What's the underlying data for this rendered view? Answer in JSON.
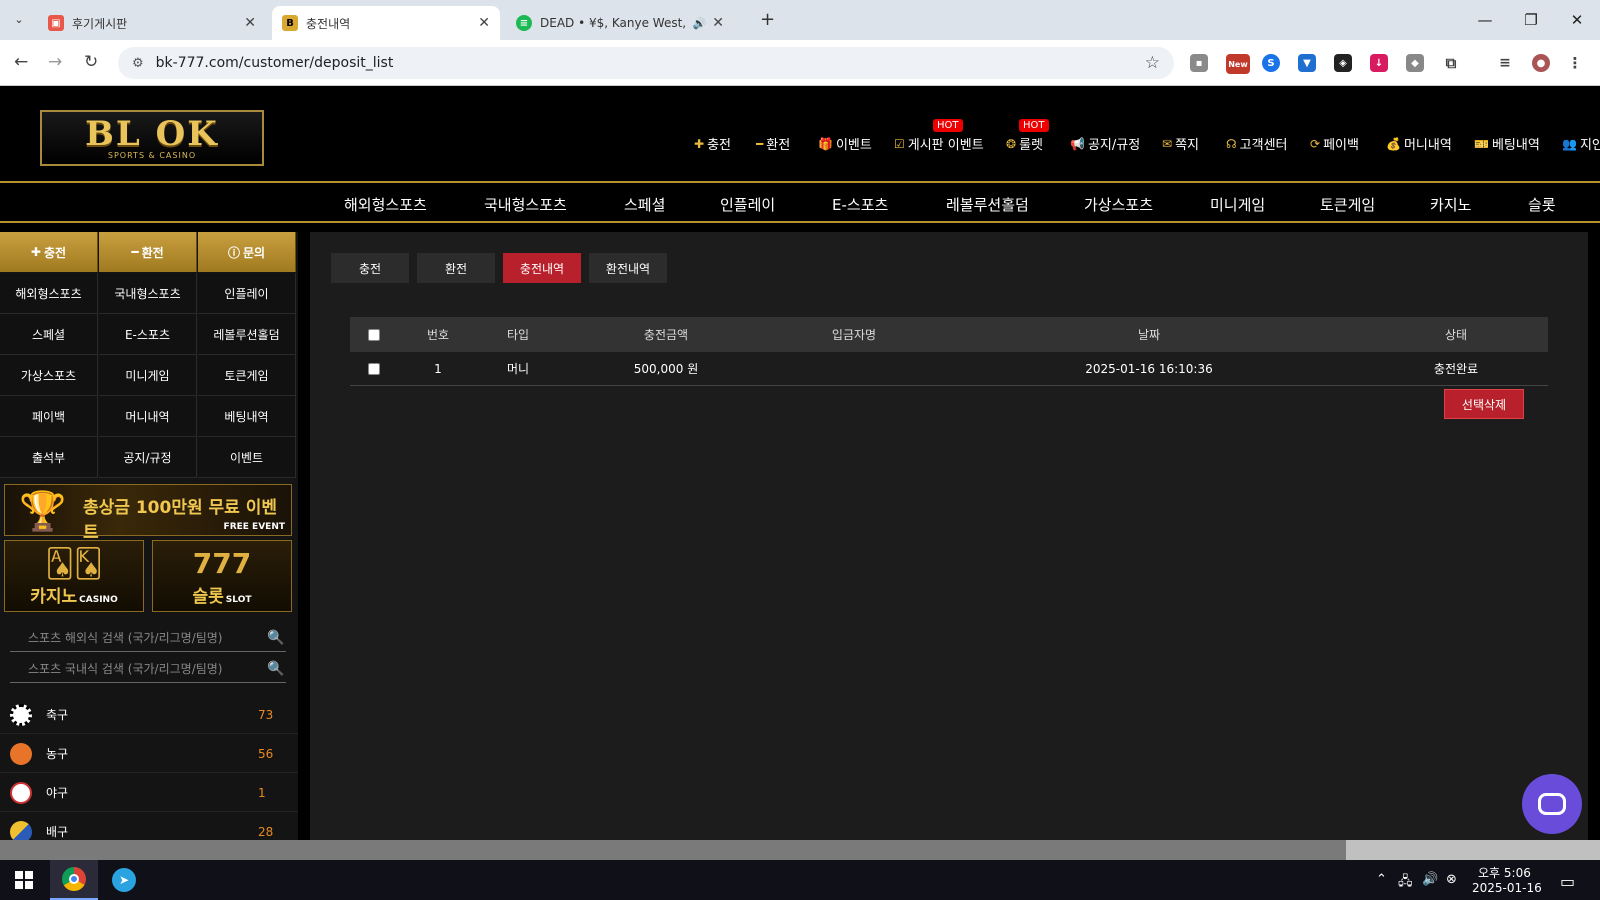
{
  "browser": {
    "tabs": [
      {
        "title": "후기게시판",
        "active": false
      },
      {
        "title": "충전내역",
        "active": true
      },
      {
        "title": "DEAD • ¥$, Kanye West, Ty",
        "active": false
      }
    ],
    "url": "bk-777.com/customer/deposit_list",
    "ext_new_badge": "New"
  },
  "site": {
    "logo_text": "BL  OK",
    "logo_sub": "SPORTS & CASINO",
    "top_menu": [
      {
        "label": "충전",
        "icon": "plus-icon"
      },
      {
        "label": "환전",
        "icon": "minus-icon"
      },
      {
        "label": "이벤트",
        "icon": "gift-icon"
      },
      {
        "label": "게시판 이벤트",
        "icon": "checkbox-icon",
        "badge": "HOT"
      },
      {
        "label": "룰렛",
        "icon": "roulette-icon",
        "badge": "HOT"
      },
      {
        "label": "공지/규정",
        "icon": "megaphone-icon"
      },
      {
        "label": "쪽지",
        "icon": "mail-icon"
      },
      {
        "label": "고객센터",
        "icon": "headset-icon"
      },
      {
        "label": "페이백",
        "icon": "refresh-icon"
      },
      {
        "label": "머니내역",
        "icon": "money-bag-icon"
      },
      {
        "label": "베팅내역",
        "icon": "ticket-icon"
      },
      {
        "label": "지인",
        "icon": "users-icon"
      }
    ],
    "main_nav": [
      "해외형스포츠",
      "국내형스포츠",
      "스페셜",
      "인플레이",
      "E-스포츠",
      "레볼루션홀덤",
      "가상스포츠",
      "미니게임",
      "토큰게임",
      "카지노",
      "슬롯"
    ]
  },
  "sidebar": {
    "buttons": [
      {
        "label": "충전",
        "icon": "plus-icon"
      },
      {
        "label": "환전",
        "icon": "minus-icon"
      },
      {
        "label": "문의",
        "icon": "info-icon"
      }
    ],
    "grid": [
      "해외형스포츠",
      "국내형스포츠",
      "인플레이",
      "스페셜",
      "E-스포츠",
      "레볼루션홀덤",
      "가상스포츠",
      "미니게임",
      "토큰게임",
      "페이백",
      "머니내역",
      "베팅내역",
      "출석부",
      "공지/규정",
      "이벤트"
    ],
    "banner_event": {
      "title": "총상금 100만원 무료 이벤트",
      "sub": "FREE EVENT"
    },
    "banner_casino": {
      "title": "카지노",
      "sub": "CASINO"
    },
    "banner_slot": {
      "title": "슬롯",
      "sub": "SLOT",
      "reels": "777"
    },
    "search_overseas_placeholder": "스포츠 해외식 검색 (국가/리그명/팀명)",
    "search_domestic_placeholder": "스포츠 국내식 검색 (국가/리그명/팀명)",
    "sports": [
      {
        "name": "축구",
        "count": "73",
        "icon": "soccer-icon",
        "color": "#ffffff"
      },
      {
        "name": "농구",
        "count": "56",
        "icon": "basketball-icon",
        "color": "#e8742a"
      },
      {
        "name": "야구",
        "count": "1",
        "icon": "baseball-icon",
        "color": "#ffffff"
      },
      {
        "name": "배구",
        "count": "28",
        "icon": "volleyball-icon",
        "color": "#f0c030"
      }
    ]
  },
  "content": {
    "tabs": [
      {
        "label": "충전",
        "active": false
      },
      {
        "label": "환전",
        "active": false
      },
      {
        "label": "충전내역",
        "active": true
      },
      {
        "label": "환전내역",
        "active": false
      }
    ],
    "table": {
      "headers": [
        "번호",
        "타입",
        "충전금액",
        "입금자명",
        "날짜",
        "상태"
      ],
      "rows": [
        {
          "no": "1",
          "type": "머니",
          "amount": "500,000 원",
          "depositor": "",
          "date": "2025-01-16 16:10:36",
          "status": "충전완료"
        }
      ]
    },
    "delete_label": "선택삭제"
  },
  "taskbar": {
    "time": "오후 5:06",
    "date": "2025-01-16"
  },
  "colors": {
    "accent_gold": "#b8902b",
    "active_red": "#b8212b",
    "chat_purple": "#6a4cdb"
  }
}
